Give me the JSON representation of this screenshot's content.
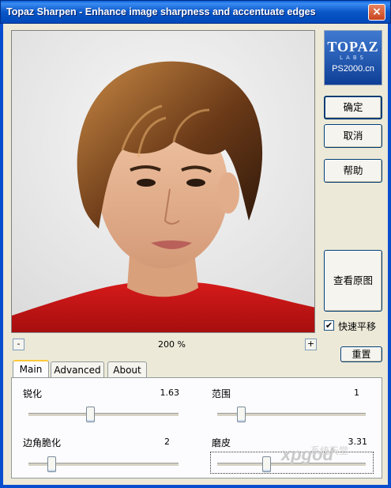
{
  "window": {
    "title": "Topaz Sharpen - Enhance image sharpness and accentuate edges",
    "close_glyph": "×"
  },
  "logo": {
    "brand": "TOPAZ",
    "sub": "LABS",
    "site": "PS2000.cn"
  },
  "buttons": {
    "ok": "确定",
    "cancel": "取消",
    "help": "帮助",
    "view_original": "查看原图",
    "reset": "重置"
  },
  "fast_pan": {
    "label": "快速平移",
    "checked": true,
    "mark": "✔"
  },
  "zoom": {
    "minus": "-",
    "plus": "+",
    "value": "200 %"
  },
  "tabs": [
    {
      "label": "Main",
      "active": true
    },
    {
      "label": "Advanced",
      "active": false
    },
    {
      "label": "About",
      "active": false
    }
  ],
  "sliders": {
    "sharpen": {
      "label": "锐化",
      "value": "1.63",
      "level": 0.41
    },
    "range": {
      "label": "范围",
      "value": "1",
      "level": 0.16
    },
    "edge_fade": {
      "label": "边角脆化",
      "value": "2",
      "level": 0.15
    },
    "skin_smooth": {
      "label": "磨皮",
      "value": "3.31",
      "level": 0.33
    }
  },
  "watermark": {
    "text": "xpgod",
    "cn": "系统天堂"
  },
  "colors": {
    "titlebar": "#0a57c8",
    "dialog_bg": "#ece9d8",
    "shirt_red": "#c81414",
    "tab_highlight": "#ffc83c"
  }
}
